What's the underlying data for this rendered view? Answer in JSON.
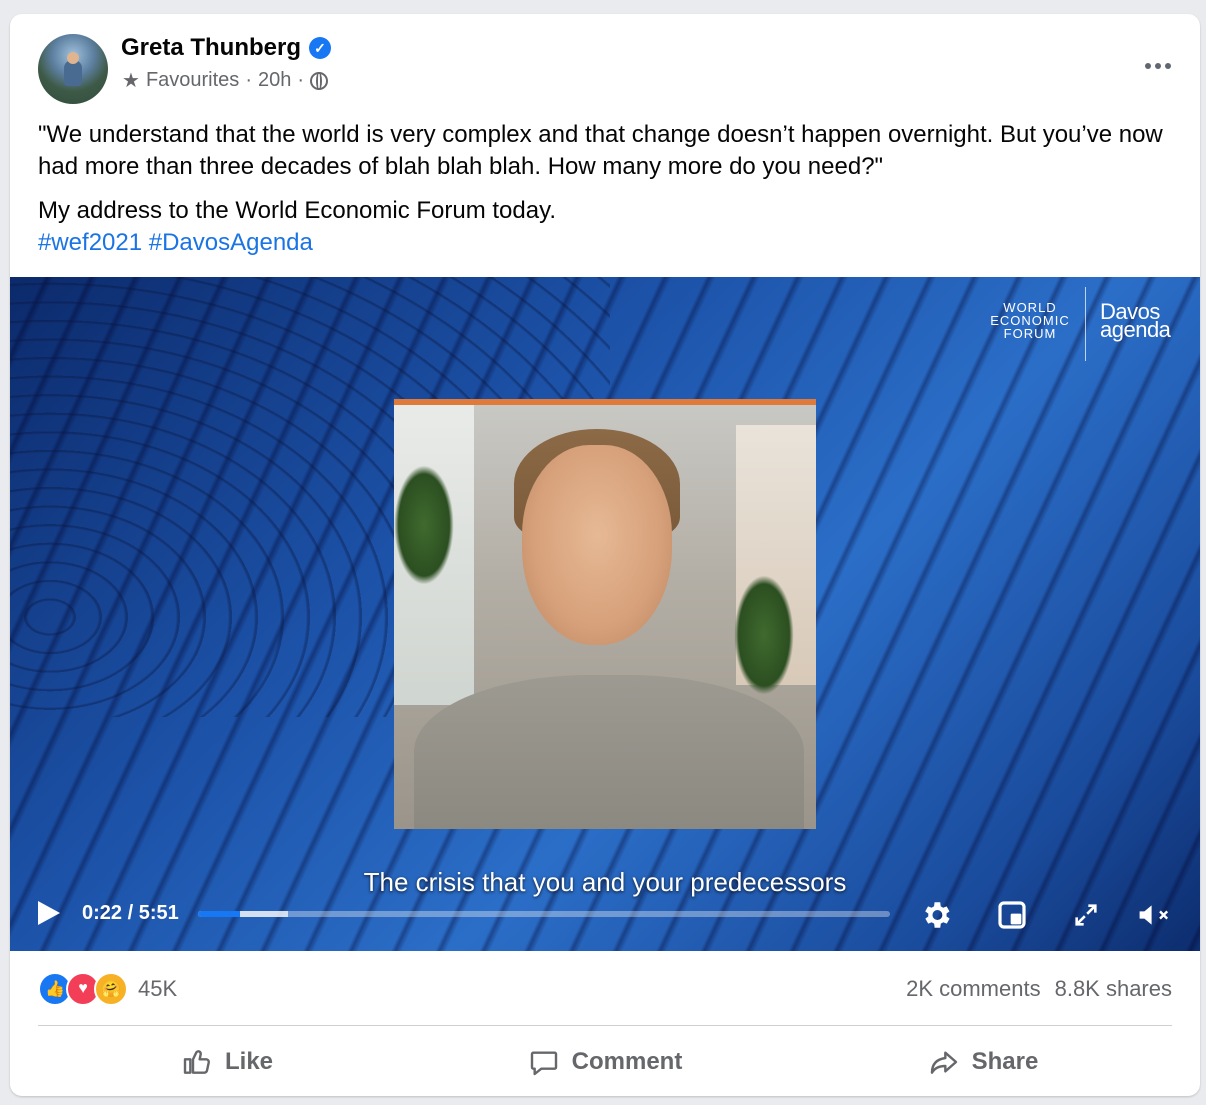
{
  "post": {
    "author": "Greta Thunberg",
    "verified_icon": "verified-check-icon",
    "audience": "Favourites",
    "time": "20h",
    "separator": "·",
    "quote": "\"We understand that the world is very complex and that change doesn’t happen overnight. But you’ve now had more than three decades of blah blah blah. How many more do you need?\"",
    "body": "My address to the World Economic Forum today.",
    "hashtags": "#wef2021 #DavosAgenda"
  },
  "video": {
    "logo_wef_line1": "WORLD",
    "logo_wef_line2": "ECONOMIC",
    "logo_wef_line3": "FORUM",
    "logo_davos_line1": "Davos",
    "logo_davos_line2": "agenda",
    "caption": "The crisis that you and your predecessors",
    "time_display": "0:22 / 5:51",
    "progress_played": 0.06,
    "progress_buffered": 0.13
  },
  "engagement": {
    "reaction_count": "45K",
    "comments": "2K comments",
    "shares": "8.8K shares"
  },
  "actions": {
    "like": "Like",
    "comment": "Comment",
    "share": "Share"
  },
  "colors": {
    "brand_blue": "#1877f2",
    "love_red": "#f33e58",
    "care_yellow": "#f7b125",
    "hashtag_blue": "#1b74e4"
  }
}
